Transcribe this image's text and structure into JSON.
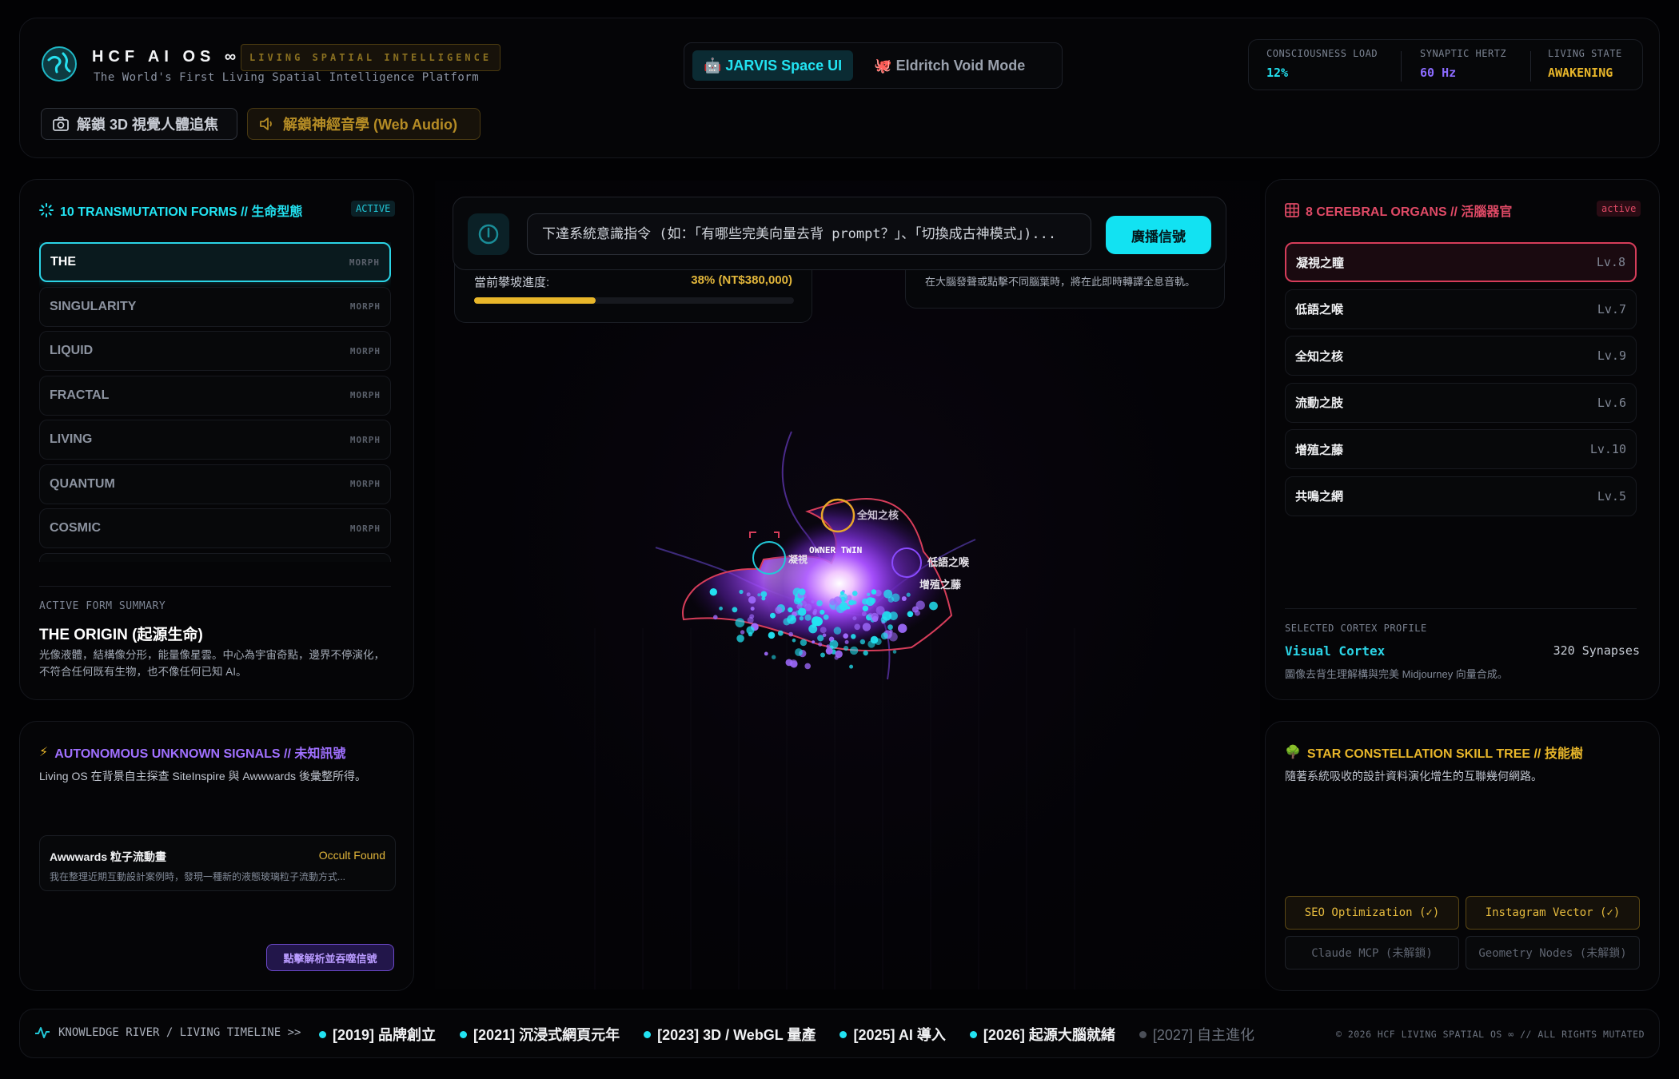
{
  "header": {
    "brand": "HCF AI OS ∞",
    "brand_tag": "LIVING SPATIAL INTELLIGENCE",
    "subtitle": "The World's First Living Spatial Intelligence Platform",
    "btn_camera": "解鎖 3D 視覺人體追焦",
    "btn_audio": "解鎖神經音學 (Web Audio)",
    "modes": [
      "🤖 JARVIS Space UI",
      "🐙 Eldritch Void Mode"
    ],
    "stats": [
      {
        "label": "CONSCIOUSNESS LOAD",
        "value": "12%",
        "color": "#22e3f2"
      },
      {
        "label": "SYNAPTIC HERTZ",
        "value": "60 Hz",
        "color": "#8b6bff"
      },
      {
        "label": "LIVING STATE",
        "value": "AWAKENING",
        "color": "#e8b62a"
      }
    ]
  },
  "forms": {
    "title": "10 TRANSMUTATION FORMS // 生命型態",
    "badge": "ACTIVE",
    "morph_label": "MORPH",
    "items": [
      "THE",
      "SINGULARITY",
      "LIQUID",
      "FRACTAL",
      "LIVING",
      "QUANTUM",
      "COSMIC",
      ""
    ],
    "summary_label": "ACTIVE FORM SUMMARY",
    "summary_title": "THE ORIGIN (起源生命)",
    "summary_desc": "光像液體，結構像分形，能量像星雲。中心為宇宙奇點，邊界不停演化，不符合任何既有生物，也不像任何已知 AI。"
  },
  "signals": {
    "title": "AUTONOMOUS UNKNOWN SIGNALS // 未知訊號",
    "desc": "Living OS 在背景自主探查 SiteInspire 與 Awwwards 後彙整所得。",
    "card_title": "Awwwards 粒子流動畫",
    "card_status": "Occult Found",
    "card_desc": "我在整理近期互動設計案例時，發現一種新的液態玻璃粒子流動方式...",
    "button": "點擊解析並吞噬信號"
  },
  "center": {
    "command_placeholder": "下達系統意識指令 (如：「有哪些完美向量去背 prompt？」、「切換成古神模式」)...",
    "send_button": "廣播信號",
    "progress_label": "當前攀坡進度:",
    "progress_value": "38% (NT$380,000)",
    "progress_fraction": 0.38,
    "audio_hint": "在大腦發聲或點擊不同腦葉時，將在此即時轉譯全息音軌。",
    "orb_labels": {
      "owner": "OWNER TWIN",
      "n1": "全知之核",
      "n2": "低語之喉",
      "n3": "增殖之藤",
      "n4": "凝視"
    }
  },
  "organs": {
    "title": "8 CEREBRAL ORGANS // 活腦器官",
    "badge": "active",
    "items": [
      {
        "name": "凝視之瞳",
        "level": "Lv.8"
      },
      {
        "name": "低語之喉",
        "level": "Lv.7"
      },
      {
        "name": "全知之核",
        "level": "Lv.9"
      },
      {
        "name": "流動之肢",
        "level": "Lv.6"
      },
      {
        "name": "增殖之藤",
        "level": "Lv.10"
      },
      {
        "name": "共鳴之網",
        "level": "Lv.5"
      }
    ],
    "cortex_label": "SELECTED CORTEX PROFILE",
    "cortex_name": "Visual Cortex",
    "cortex_synapses": "320 Synapses",
    "cortex_desc": "圖像去背生理解構與完美 Midjourney 向量合成。"
  },
  "skills": {
    "title": "STAR CONSTELLATION SKILL TREE // 技能樹",
    "desc": "隨著系統吸收的設計資料演化增生的互聯幾何網路。",
    "items": [
      {
        "label": "SEO Optimization (✓)",
        "unlocked": true
      },
      {
        "label": "Instagram Vector (✓)",
        "unlocked": true
      },
      {
        "label": "Claude MCP (未解鎖)",
        "unlocked": false
      },
      {
        "label": "Geometry Nodes (未解鎖)",
        "unlocked": false
      }
    ]
  },
  "footer": {
    "timeline_label": "KNOWLEDGE RIVER / LIVING TIMELINE >>",
    "timeline": [
      {
        "label": "[2019] 品牌創立",
        "future": false
      },
      {
        "label": "[2021] 沉浸式網頁元年",
        "future": false
      },
      {
        "label": "[2023] 3D / WebGL 量產",
        "future": false
      },
      {
        "label": "[2025] AI 導入",
        "future": false
      },
      {
        "label": "[2026] 起源大腦就緒",
        "future": false
      },
      {
        "label": "[2027] 自主進化",
        "future": true
      }
    ],
    "copyright": "© 2026 HCF LIVING SPATIAL OS ∞ // ALL RIGHTS MUTATED"
  },
  "colors": {
    "cyan": "#22e3f2",
    "violet": "#8b6bff",
    "gold": "#e8b62a",
    "crimson": "#d63d5a"
  }
}
